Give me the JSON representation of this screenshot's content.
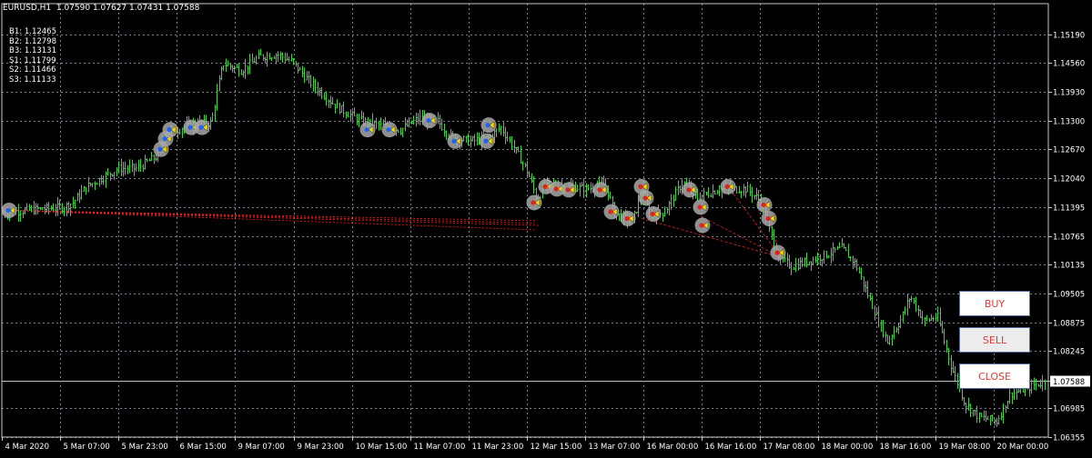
{
  "header": {
    "symbol": "EURUSD,H1",
    "ohlc": "1.07590 1.07627 1.07431 1.07588"
  },
  "levels": [
    {
      "label": "B1",
      "value": "1.12465"
    },
    {
      "label": "B2",
      "value": "1.12798"
    },
    {
      "label": "B3",
      "value": "1.13131"
    },
    {
      "label": "S1",
      "value": "1.11799"
    },
    {
      "label": "S2",
      "value": "1.11466"
    },
    {
      "label": "S3",
      "value": "1.11133"
    }
  ],
  "buttons": {
    "buy": "BUY",
    "sell": "SELL",
    "close": "CLOSE"
  },
  "colors": {
    "background": "#000000",
    "candles": "#3fd13f",
    "grid": "#7a8090",
    "axis_text": "#ffffff",
    "button_text": "#e53935",
    "signal_line": "#ff2020"
  },
  "chart_data": {
    "type": "candlestick",
    "title": "EURUSD,H1",
    "y_axis": {
      "min": 1.06355,
      "max": 1.15865,
      "ticks": [
        "1.15190",
        "1.14560",
        "1.13930",
        "1.13300",
        "1.12670",
        "1.12040",
        "1.11395",
        "1.10765",
        "1.10135",
        "1.09505",
        "1.08875",
        "1.08245",
        "1.07588",
        "1.06985",
        "1.06355"
      ],
      "current_price": "1.07588"
    },
    "x_axis": {
      "ticks": [
        "4 Mar 2020",
        "5 Mar 07:00",
        "5 Mar 23:00",
        "6 Mar 15:00",
        "9 Mar 07:00",
        "9 Mar 23:00",
        "10 Mar 15:00",
        "11 Mar 07:00",
        "11 Mar 23:00",
        "12 Mar 15:00",
        "13 Mar 07:00",
        "16 Mar 00:00",
        "16 Mar 16:00",
        "17 Mar 08:00",
        "18 Mar 00:00",
        "18 Mar 16:00",
        "19 Mar 08:00",
        "20 Mar 00:00"
      ]
    },
    "price_path": [
      [
        0,
        1.1128
      ],
      [
        70,
        1.114
      ],
      [
        80,
        1.115
      ],
      [
        95,
        1.1185
      ],
      [
        130,
        1.1225
      ],
      [
        150,
        1.1225
      ],
      [
        175,
        1.1255
      ],
      [
        180,
        1.1305
      ],
      [
        195,
        1.131
      ],
      [
        215,
        1.1325
      ],
      [
        232,
        1.1325
      ],
      [
        240,
        1.141
      ],
      [
        245,
        1.1455
      ],
      [
        265,
        1.144
      ],
      [
        285,
        1.147
      ],
      [
        305,
        1.1475
      ],
      [
        320,
        1.146
      ],
      [
        340,
        1.1415
      ],
      [
        370,
        1.136
      ],
      [
        395,
        1.133
      ],
      [
        420,
        1.1318
      ],
      [
        440,
        1.131
      ],
      [
        460,
        1.1335
      ],
      [
        480,
        1.133
      ],
      [
        495,
        1.1295
      ],
      [
        515,
        1.1285
      ],
      [
        535,
        1.129
      ],
      [
        550,
        1.1315
      ],
      [
        565,
        1.127
      ],
      [
        580,
        1.1215
      ],
      [
        590,
        1.1155
      ],
      [
        598,
        1.119
      ],
      [
        625,
        1.1185
      ],
      [
        645,
        1.118
      ],
      [
        665,
        1.119
      ],
      [
        675,
        1.1125
      ],
      [
        695,
        1.111
      ],
      [
        705,
        1.1175
      ],
      [
        715,
        1.112
      ],
      [
        730,
        1.113
      ],
      [
        750,
        1.1195
      ],
      [
        765,
        1.116
      ],
      [
        790,
        1.118
      ],
      [
        820,
        1.118
      ],
      [
        835,
        1.1155
      ],
      [
        855,
        1.103
      ],
      [
        870,
        1.101
      ],
      [
        900,
        1.103
      ],
      [
        925,
        1.105
      ],
      [
        940,
        1.1015
      ],
      [
        960,
        1.0915
      ],
      [
        975,
        1.0845
      ],
      [
        990,
        1.0895
      ],
      [
        1000,
        1.0945
      ],
      [
        1015,
        1.089
      ],
      [
        1030,
        1.09
      ],
      [
        1045,
        1.079
      ],
      [
        1060,
        1.071
      ],
      [
        1075,
        1.068
      ],
      [
        1095,
        1.067
      ],
      [
        1110,
        1.073
      ],
      [
        1148,
        1.0758
      ]
    ],
    "buy_signals": [
      [
        10,
        1.1133
      ],
      [
        177,
        1.1267
      ],
      [
        182,
        1.129
      ],
      [
        187,
        1.131
      ],
      [
        210,
        1.1315
      ],
      [
        222,
        1.1315
      ],
      [
        404,
        1.131
      ],
      [
        428,
        1.131
      ],
      [
        472,
        1.133
      ],
      [
        500,
        1.1285
      ],
      [
        535,
        1.1285
      ],
      [
        537,
        1.132
      ]
    ],
    "sell_signals": [
      [
        587,
        1.115
      ],
      [
        600,
        1.1185
      ],
      [
        612,
        1.118
      ],
      [
        625,
        1.1178
      ],
      [
        660,
        1.1178
      ],
      [
        672,
        1.113
      ],
      [
        690,
        1.1115
      ],
      [
        705,
        1.1185
      ],
      [
        710,
        1.116
      ],
      [
        718,
        1.1125
      ],
      [
        758,
        1.1178
      ],
      [
        770,
        1.114
      ],
      [
        772,
        1.11
      ],
      [
        800,
        1.1185
      ],
      [
        840,
        1.1145
      ],
      [
        845,
        1.1115
      ],
      [
        855,
        1.104
      ]
    ]
  }
}
